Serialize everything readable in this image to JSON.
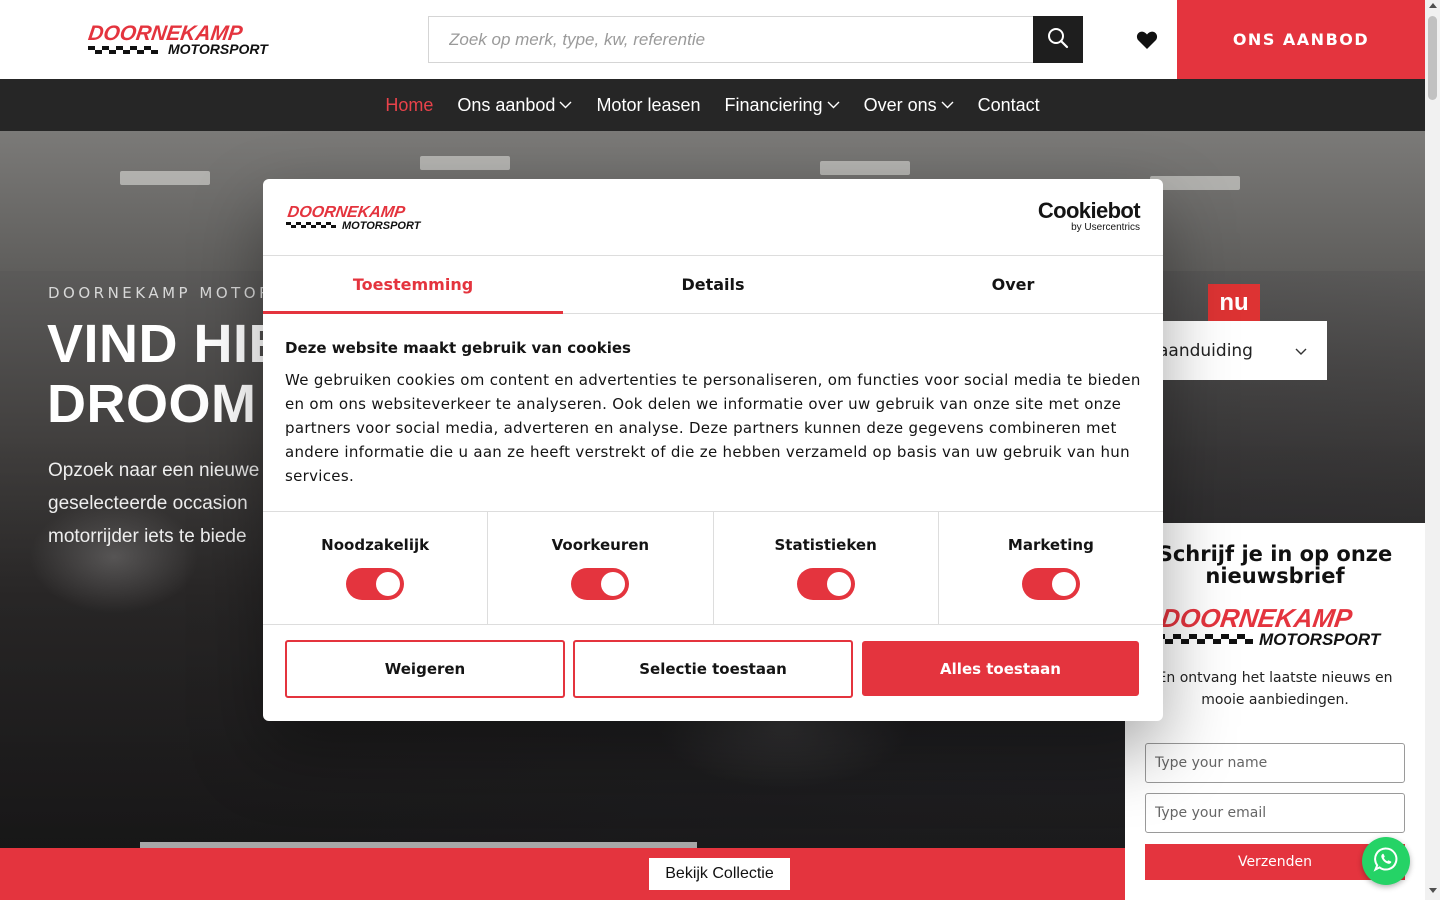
{
  "header": {
    "logo_line1": "DOORNEKAMP",
    "logo_line2": "MOTORSPORT",
    "search_placeholder": "Zoek op merk, type, kw, referentie",
    "aanbod_button": "ONS AANBOD"
  },
  "nav": {
    "items": [
      {
        "label": "Home",
        "active": true,
        "dropdown": false
      },
      {
        "label": "Ons aanbod",
        "active": false,
        "dropdown": true
      },
      {
        "label": "Motor leasen",
        "active": false,
        "dropdown": false
      },
      {
        "label": "Financiering",
        "active": false,
        "dropdown": true
      },
      {
        "label": "Over ons",
        "active": false,
        "dropdown": true
      },
      {
        "label": "Contact",
        "active": false,
        "dropdown": false
      }
    ]
  },
  "hero": {
    "eyebrow": "DOORNEKAMP MOTORSP",
    "title_line1": "VIND HIE",
    "title_line2": "DROOM",
    "text_line1": "Opzoek naar een nieuwe",
    "text_line2": "geselecteerde occasion",
    "text_line3": "motorrijder iets te biede",
    "select_value": "aanduiding",
    "sign_text": "nu"
  },
  "newsletter": {
    "title": "Schrijf je in op onze nieuwsbrief",
    "logo_line1": "DOORNEKAMP",
    "logo_line2": "MOTORSPORT",
    "text": "En ontvang het laatste nieuws en mooie aanbiedingen.",
    "name_placeholder": "Type your name",
    "email_placeholder": "Type your email",
    "submit": "Verzenden"
  },
  "bottom": {
    "collection_button": "Bekijk Collectie"
  },
  "cookie": {
    "logo_line1": "DOORNEKAMP",
    "logo_line2": "MOTORSPORT",
    "brand_big": "Cookiebot",
    "brand_small": "by Usercentrics",
    "tabs": [
      "Toestemming",
      "Details",
      "Over"
    ],
    "heading": "Deze website maakt gebruik van cookies",
    "body": "We gebruiken cookies om content en advertenties te personaliseren, om functies voor social media te bieden en om ons websiteverkeer te analyseren. Ook delen we informatie over uw gebruik van onze site met onze partners voor social media, adverteren en analyse. Deze partners kunnen deze gegevens combineren met andere informatie die u aan ze heeft verstrekt of die ze hebben verzameld op basis van uw gebruik van hun services.",
    "toggles": [
      {
        "label": "Noodzakelijk",
        "on": true
      },
      {
        "label": "Voorkeuren",
        "on": true
      },
      {
        "label": "Statistieken",
        "on": true
      },
      {
        "label": "Marketing",
        "on": true
      }
    ],
    "buttons": {
      "deny": "Weigeren",
      "selection": "Selectie toestaan",
      "allow_all": "Alles toestaan"
    }
  },
  "colors": {
    "brand_red": "#e4343e",
    "nav_bg": "#262626",
    "whatsapp": "#25d366"
  }
}
